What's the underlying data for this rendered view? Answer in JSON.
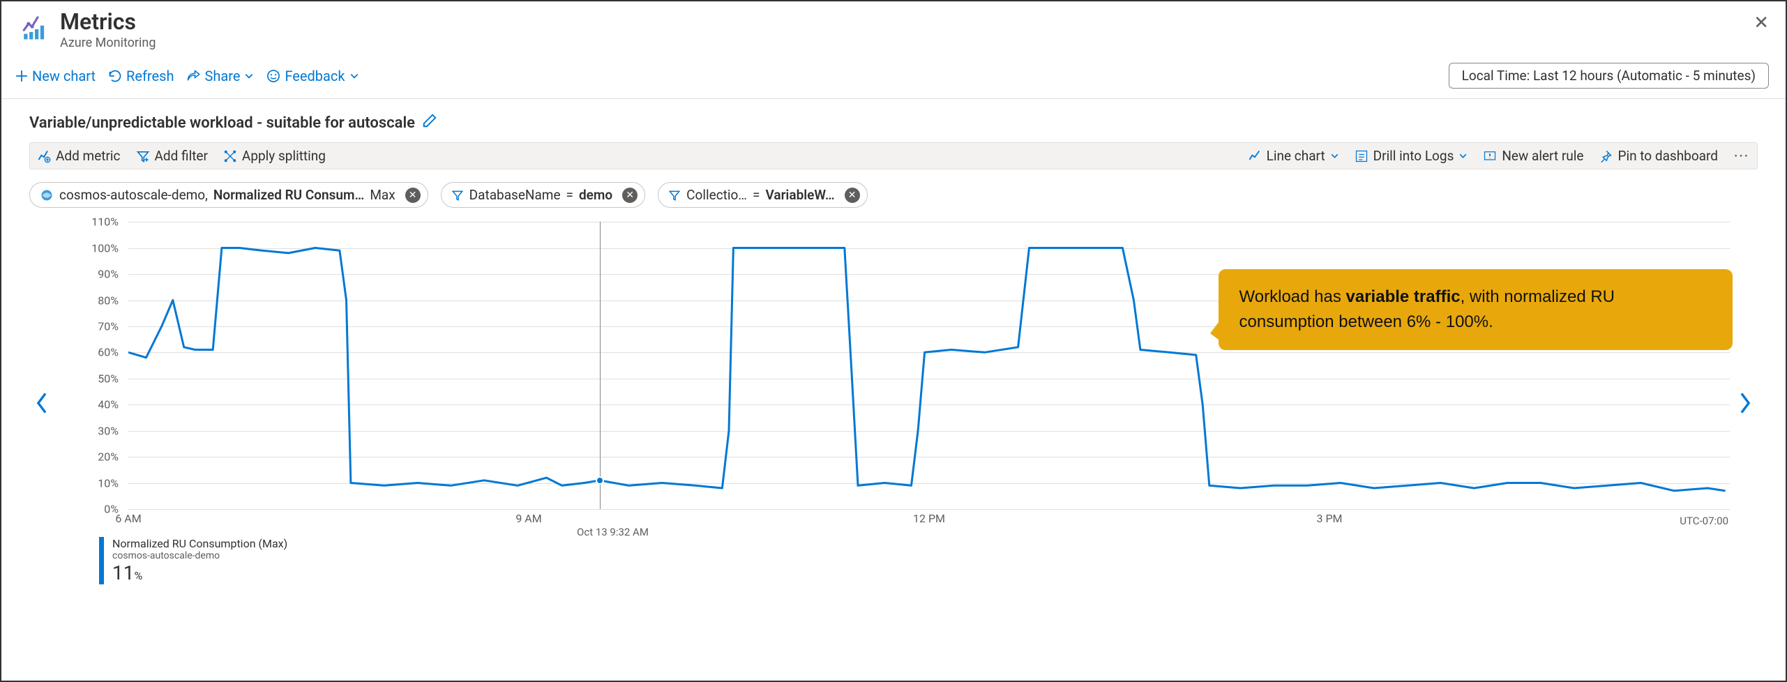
{
  "header": {
    "title": "Metrics",
    "subtitle": "Azure Monitoring"
  },
  "cmdbar": {
    "new_chart": "New chart",
    "refresh": "Refresh",
    "share": "Share",
    "feedback": "Feedback",
    "time_pill": "Local Time: Last 12 hours (Automatic - 5 minutes)"
  },
  "chart": {
    "title": "Variable/unpredictable workload - suitable for autoscale"
  },
  "toolbar": {
    "add_metric": "Add metric",
    "add_filter": "Add filter",
    "apply_splitting": "Apply splitting",
    "line_chart": "Line chart",
    "drill_logs": "Drill into Logs",
    "new_alert": "New alert rule",
    "pin": "Pin to dashboard"
  },
  "pills": {
    "metric_scope": "cosmos-autoscale-demo,",
    "metric_name": "Normalized RU Consum…",
    "metric_agg": "Max",
    "db_label": "DatabaseName",
    "db_value": "demo",
    "coll_label": "Collectio…",
    "coll_value": "VariableW…"
  },
  "hover": {
    "time_label": "Oct 13 9:32 AM"
  },
  "callout": {
    "pre": "Workload has ",
    "bold": "variable traffic",
    "post": ", with normalized RU consumption between 6% - 100%."
  },
  "legend": {
    "line1": "Normalized RU Consumption (Max)",
    "line2": "cosmos-autoscale-demo",
    "value": "11",
    "suffix": "%"
  },
  "axis": {
    "utc": "UTC-07:00",
    "x_ticks": [
      "6 AM",
      "9 AM",
      "12 PM",
      "3 PM"
    ]
  },
  "chart_data": {
    "type": "line",
    "title": "Normalized RU Consumption (Max)",
    "xlabel": "",
    "ylabel": "",
    "ylim": [
      0,
      110
    ],
    "y_ticks": [
      0,
      10,
      20,
      30,
      40,
      50,
      60,
      70,
      80,
      90,
      100,
      110
    ],
    "y_tick_labels": [
      "0%",
      "10%",
      "20%",
      "30%",
      "40%",
      "50%",
      "60%",
      "70%",
      "80%",
      "90%",
      "100%",
      "110%"
    ],
    "x_range_minutes": [
      0,
      720
    ],
    "x_tick_positions": [
      0,
      180,
      360,
      540
    ],
    "x_tick_labels": [
      "6 AM",
      "9 AM",
      "12 PM",
      "3 PM"
    ],
    "hover_x": 212,
    "hover_y": 11,
    "series": [
      {
        "name": "Normalized RU Consumption (Max)",
        "color": "#0078d4",
        "points": [
          [
            0,
            60
          ],
          [
            8,
            58
          ],
          [
            15,
            70
          ],
          [
            20,
            80
          ],
          [
            25,
            62
          ],
          [
            30,
            61
          ],
          [
            38,
            61
          ],
          [
            42,
            100
          ],
          [
            50,
            100
          ],
          [
            60,
            99
          ],
          [
            72,
            98
          ],
          [
            84,
            100
          ],
          [
            95,
            99
          ],
          [
            98,
            80
          ],
          [
            100,
            10
          ],
          [
            115,
            9
          ],
          [
            130,
            10
          ],
          [
            145,
            9
          ],
          [
            160,
            11
          ],
          [
            175,
            9
          ],
          [
            188,
            12
          ],
          [
            195,
            9
          ],
          [
            205,
            10
          ],
          [
            212,
            11
          ],
          [
            225,
            9
          ],
          [
            240,
            10
          ],
          [
            255,
            9
          ],
          [
            267,
            8
          ],
          [
            270,
            30
          ],
          [
            272,
            100
          ],
          [
            285,
            100
          ],
          [
            300,
            100
          ],
          [
            315,
            100
          ],
          [
            322,
            100
          ],
          [
            325,
            55
          ],
          [
            328,
            9
          ],
          [
            340,
            10
          ],
          [
            352,
            9
          ],
          [
            355,
            30
          ],
          [
            358,
            60
          ],
          [
            370,
            61
          ],
          [
            385,
            60
          ],
          [
            400,
            62
          ],
          [
            405,
            100
          ],
          [
            418,
            100
          ],
          [
            432,
            100
          ],
          [
            447,
            100
          ],
          [
            452,
            80
          ],
          [
            455,
            61
          ],
          [
            468,
            60
          ],
          [
            480,
            59
          ],
          [
            483,
            40
          ],
          [
            486,
            9
          ],
          [
            500,
            8
          ],
          [
            515,
            9
          ],
          [
            530,
            9
          ],
          [
            545,
            10
          ],
          [
            560,
            8
          ],
          [
            575,
            9
          ],
          [
            590,
            10
          ],
          [
            605,
            8
          ],
          [
            620,
            10
          ],
          [
            635,
            10
          ],
          [
            650,
            8
          ],
          [
            665,
            9
          ],
          [
            680,
            10
          ],
          [
            695,
            7
          ],
          [
            710,
            8
          ],
          [
            718,
            7
          ]
        ]
      }
    ]
  }
}
